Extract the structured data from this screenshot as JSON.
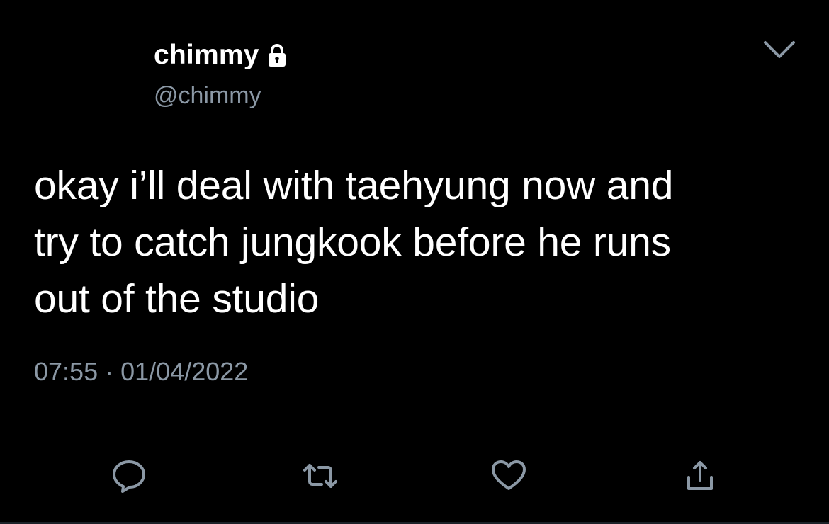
{
  "author": {
    "display_name": "chimmy",
    "handle": "@chimmy",
    "protected_icon": "lock-icon"
  },
  "menu": {
    "icon": "chevron-down-icon"
  },
  "tweet": {
    "text": "okay i’ll deal with taehyung now and\ntry to catch jungkook before he runs\nout of the studio",
    "time": "07:55",
    "separator": "·",
    "date": "01/04/2022"
  },
  "actions": [
    {
      "name": "reply",
      "icon": "reply-icon"
    },
    {
      "name": "retweet",
      "icon": "retweet-icon"
    },
    {
      "name": "like",
      "icon": "heart-icon"
    },
    {
      "name": "share",
      "icon": "share-icon"
    }
  ],
  "colors": {
    "background": "#000000",
    "primary_text": "#ffffff",
    "secondary_text": "#8b98a5",
    "divider": "#38444d"
  }
}
